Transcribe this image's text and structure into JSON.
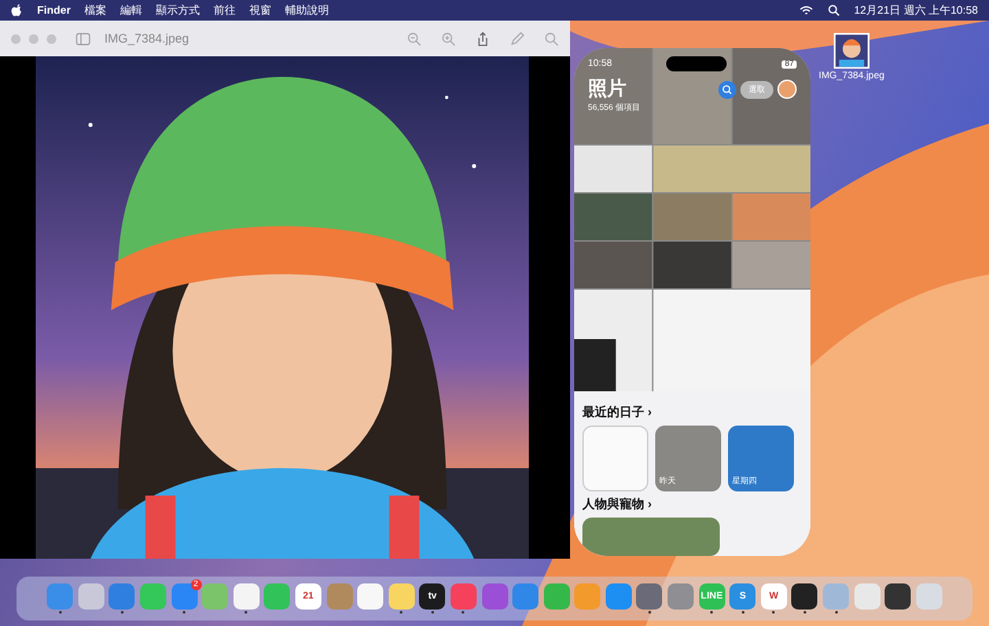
{
  "menu_bar": {
    "app": "Finder",
    "items": [
      "檔案",
      "編輯",
      "顯示方式",
      "前往",
      "視窗",
      "輔助說明"
    ],
    "clock": "12月21日 週六 上午10:58"
  },
  "preview_window": {
    "title": "IMG_7384.jpeg"
  },
  "desktop_file": {
    "name": "IMG_7384.jpeg"
  },
  "phone": {
    "time": "10:58",
    "battery": "87",
    "title": "照片",
    "count": "56,556 個項目",
    "select_button": "選取",
    "sections": [
      {
        "kind": "cards",
        "title": "最近的日子 ›",
        "cards": [
          {
            "kind": "document"
          },
          {
            "label": "昨天"
          },
          {
            "label": "星期四"
          }
        ]
      },
      {
        "kind": "album",
        "title": "人物與寵物 ›"
      }
    ]
  },
  "dock": {
    "items": [
      {
        "color": "#3b8ee8",
        "running": true
      },
      {
        "color": "#c8c8d8",
        "running": false
      },
      {
        "color": "#2f7fe0",
        "running": true
      },
      {
        "color": "#34c759",
        "running": false
      },
      {
        "color": "#2a86f5",
        "running": true,
        "badge": "2"
      },
      {
        "color": "#7cc46a",
        "running": false
      },
      {
        "color": "#f4f4f4",
        "running": true
      },
      {
        "color": "#32c25a",
        "running": false
      },
      {
        "color": "#ffffff",
        "running": false,
        "text": "21"
      },
      {
        "color": "#b08a5c",
        "running": false
      },
      {
        "color": "#f7f7f7",
        "running": false
      },
      {
        "color": "#f7d560",
        "running": true
      },
      {
        "color": "#1c1c1e",
        "running": true,
        "text": "tv"
      },
      {
        "color": "#f5415c",
        "running": true
      },
      {
        "color": "#9b4fd6",
        "running": false
      },
      {
        "color": "#2f88e8",
        "running": false
      },
      {
        "color": "#35b84a",
        "running": false
      },
      {
        "color": "#f39a2c",
        "running": false
      },
      {
        "color": "#1d8ef2",
        "running": false
      },
      {
        "color": "#6a6a78",
        "running": true
      },
      {
        "color": "#8e8e93",
        "running": false
      },
      {
        "color": "#2fc055",
        "running": true,
        "text": "LINE"
      },
      {
        "color": "#2a8fe0",
        "running": true,
        "text": "S"
      },
      {
        "color": "#fefefe",
        "running": true,
        "text": "W"
      },
      {
        "color": "#222222",
        "running": true
      },
      {
        "color": "#9fb8d8",
        "running": true
      },
      {
        "color": "#e8e8e8",
        "running": false
      },
      {
        "color": "#333333",
        "running": false
      },
      {
        "color": "#d8dde4",
        "running": false
      }
    ]
  }
}
